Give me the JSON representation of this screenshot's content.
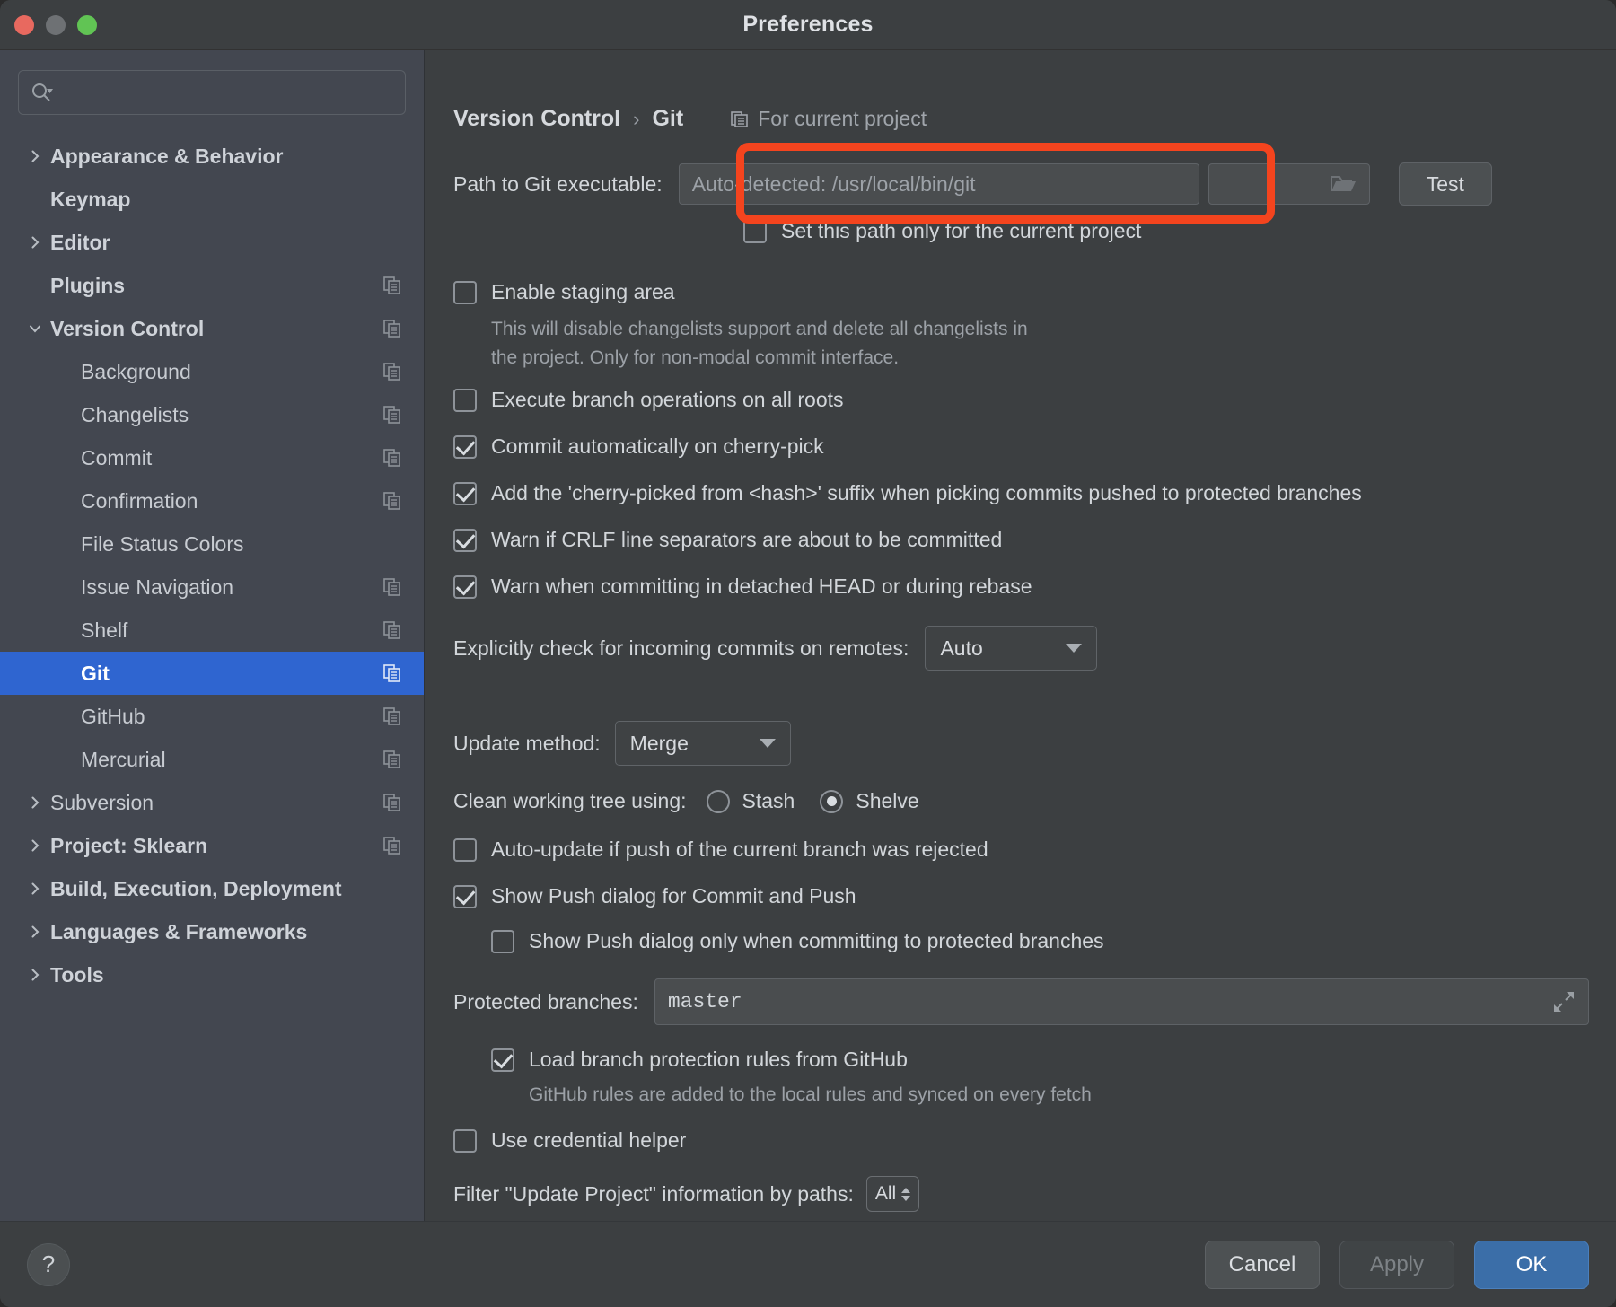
{
  "window": {
    "title": "Preferences"
  },
  "search": {
    "placeholder": "",
    "value": "",
    "icon": "search-icon"
  },
  "sidebar": {
    "items": [
      {
        "label": "Appearance & Behavior",
        "level": "top",
        "twisty": "chevron-right",
        "copy": false,
        "selected": false
      },
      {
        "label": "Keymap",
        "level": "top",
        "twisty": "none",
        "copy": false,
        "selected": false
      },
      {
        "label": "Editor",
        "level": "top",
        "twisty": "chevron-right",
        "copy": false,
        "selected": false
      },
      {
        "label": "Plugins",
        "level": "top",
        "twisty": "none",
        "copy": true,
        "selected": false
      },
      {
        "label": "Version Control",
        "level": "top",
        "twisty": "chevron-down",
        "copy": true,
        "selected": false
      },
      {
        "label": "Background",
        "level": "child",
        "twisty": "none",
        "copy": true,
        "selected": false
      },
      {
        "label": "Changelists",
        "level": "child",
        "twisty": "none",
        "copy": true,
        "selected": false
      },
      {
        "label": "Commit",
        "level": "child",
        "twisty": "none",
        "copy": true,
        "selected": false
      },
      {
        "label": "Confirmation",
        "level": "child",
        "twisty": "none",
        "copy": true,
        "selected": false
      },
      {
        "label": "File Status Colors",
        "level": "child",
        "twisty": "none",
        "copy": false,
        "selected": false
      },
      {
        "label": "Issue Navigation",
        "level": "child",
        "twisty": "none",
        "copy": true,
        "selected": false
      },
      {
        "label": "Shelf",
        "level": "child",
        "twisty": "none",
        "copy": true,
        "selected": false
      },
      {
        "label": "Git",
        "level": "child",
        "twisty": "none",
        "copy": true,
        "selected": true
      },
      {
        "label": "GitHub",
        "level": "child",
        "twisty": "none",
        "copy": true,
        "selected": false
      },
      {
        "label": "Mercurial",
        "level": "child",
        "twisty": "none",
        "copy": true,
        "selected": false
      },
      {
        "label": "Subversion",
        "level": "child-twisty",
        "twisty": "chevron-right",
        "copy": true,
        "selected": false
      },
      {
        "label": "Project: Sklearn",
        "level": "top",
        "twisty": "chevron-right",
        "copy": true,
        "selected": false
      },
      {
        "label": "Build, Execution, Deployment",
        "level": "top",
        "twisty": "chevron-right",
        "copy": false,
        "selected": false
      },
      {
        "label": "Languages & Frameworks",
        "level": "top",
        "twisty": "chevron-right",
        "copy": false,
        "selected": false
      },
      {
        "label": "Tools",
        "level": "top",
        "twisty": "chevron-right",
        "copy": false,
        "selected": false
      }
    ]
  },
  "breadcrumb": {
    "parent": "Version Control",
    "separator": "›",
    "current": "Git",
    "scope_label": "For current project",
    "scope_icon": "project-scope-icon"
  },
  "git": {
    "path_label": "Path to Git executable:",
    "path_placeholder": "Auto-detected: /usr/local/bin/git",
    "path_value": "",
    "browse_icon": "folder-icon",
    "test_button": "Test",
    "set_path_only_label": "Set this path only for the current project",
    "set_path_only_checked": false,
    "enable_staging_label": "Enable staging area",
    "enable_staging_checked": false,
    "enable_staging_hint_1": "This will disable changelists support and delete all changelists in",
    "enable_staging_hint_2": "the project. Only for non-modal commit interface.",
    "execute_branch_label": "Execute branch operations on all roots",
    "execute_branch_checked": false,
    "commit_auto_label": "Commit automatically on cherry-pick",
    "commit_auto_checked": true,
    "add_suffix_label": "Add the 'cherry-picked from <hash>' suffix when picking commits pushed to protected branches",
    "add_suffix_checked": true,
    "warn_crlf_label": "Warn if CRLF line separators are about to be committed",
    "warn_crlf_checked": true,
    "warn_detached_label": "Warn when committing in detached HEAD or during rebase",
    "warn_detached_checked": true,
    "incoming_label": "Explicitly check for incoming commits on remotes:",
    "incoming_value": "Auto",
    "update_method_label": "Update method:",
    "update_method_value": "Merge",
    "clean_tree_label": "Clean working tree using:",
    "clean_tree_option_1": "Stash",
    "clean_tree_option_2": "Shelve",
    "clean_tree_selected": "Shelve",
    "auto_update_label": "Auto-update if push of the current branch was rejected",
    "auto_update_checked": false,
    "show_push_label": "Show Push dialog for Commit and Push",
    "show_push_checked": true,
    "show_push_protected_label": "Show Push dialog only when committing to protected branches",
    "show_push_protected_checked": false,
    "protected_branches_label": "Protected branches:",
    "protected_branches_value": "master",
    "protected_branches_expand_icon": "expand-icon",
    "load_rules_label": "Load branch protection rules from GitHub",
    "load_rules_checked": true,
    "load_rules_hint": "GitHub rules are added to the local rules and synced on every fetch",
    "credential_helper_label": "Use credential helper",
    "credential_helper_checked": false,
    "filter_label": "Filter \"Update Project\" information by paths:",
    "filter_value": "All"
  },
  "footer": {
    "help_label": "?",
    "cancel_label": "Cancel",
    "apply_label": "Apply",
    "ok_label": "OK"
  },
  "colors": {
    "accent_selection": "#2f65d0",
    "primary_button": "#3b6ea8",
    "highlight_outline": "#f4441e",
    "sidebar_bg": "#434750",
    "panel_bg": "#3c3f41"
  }
}
